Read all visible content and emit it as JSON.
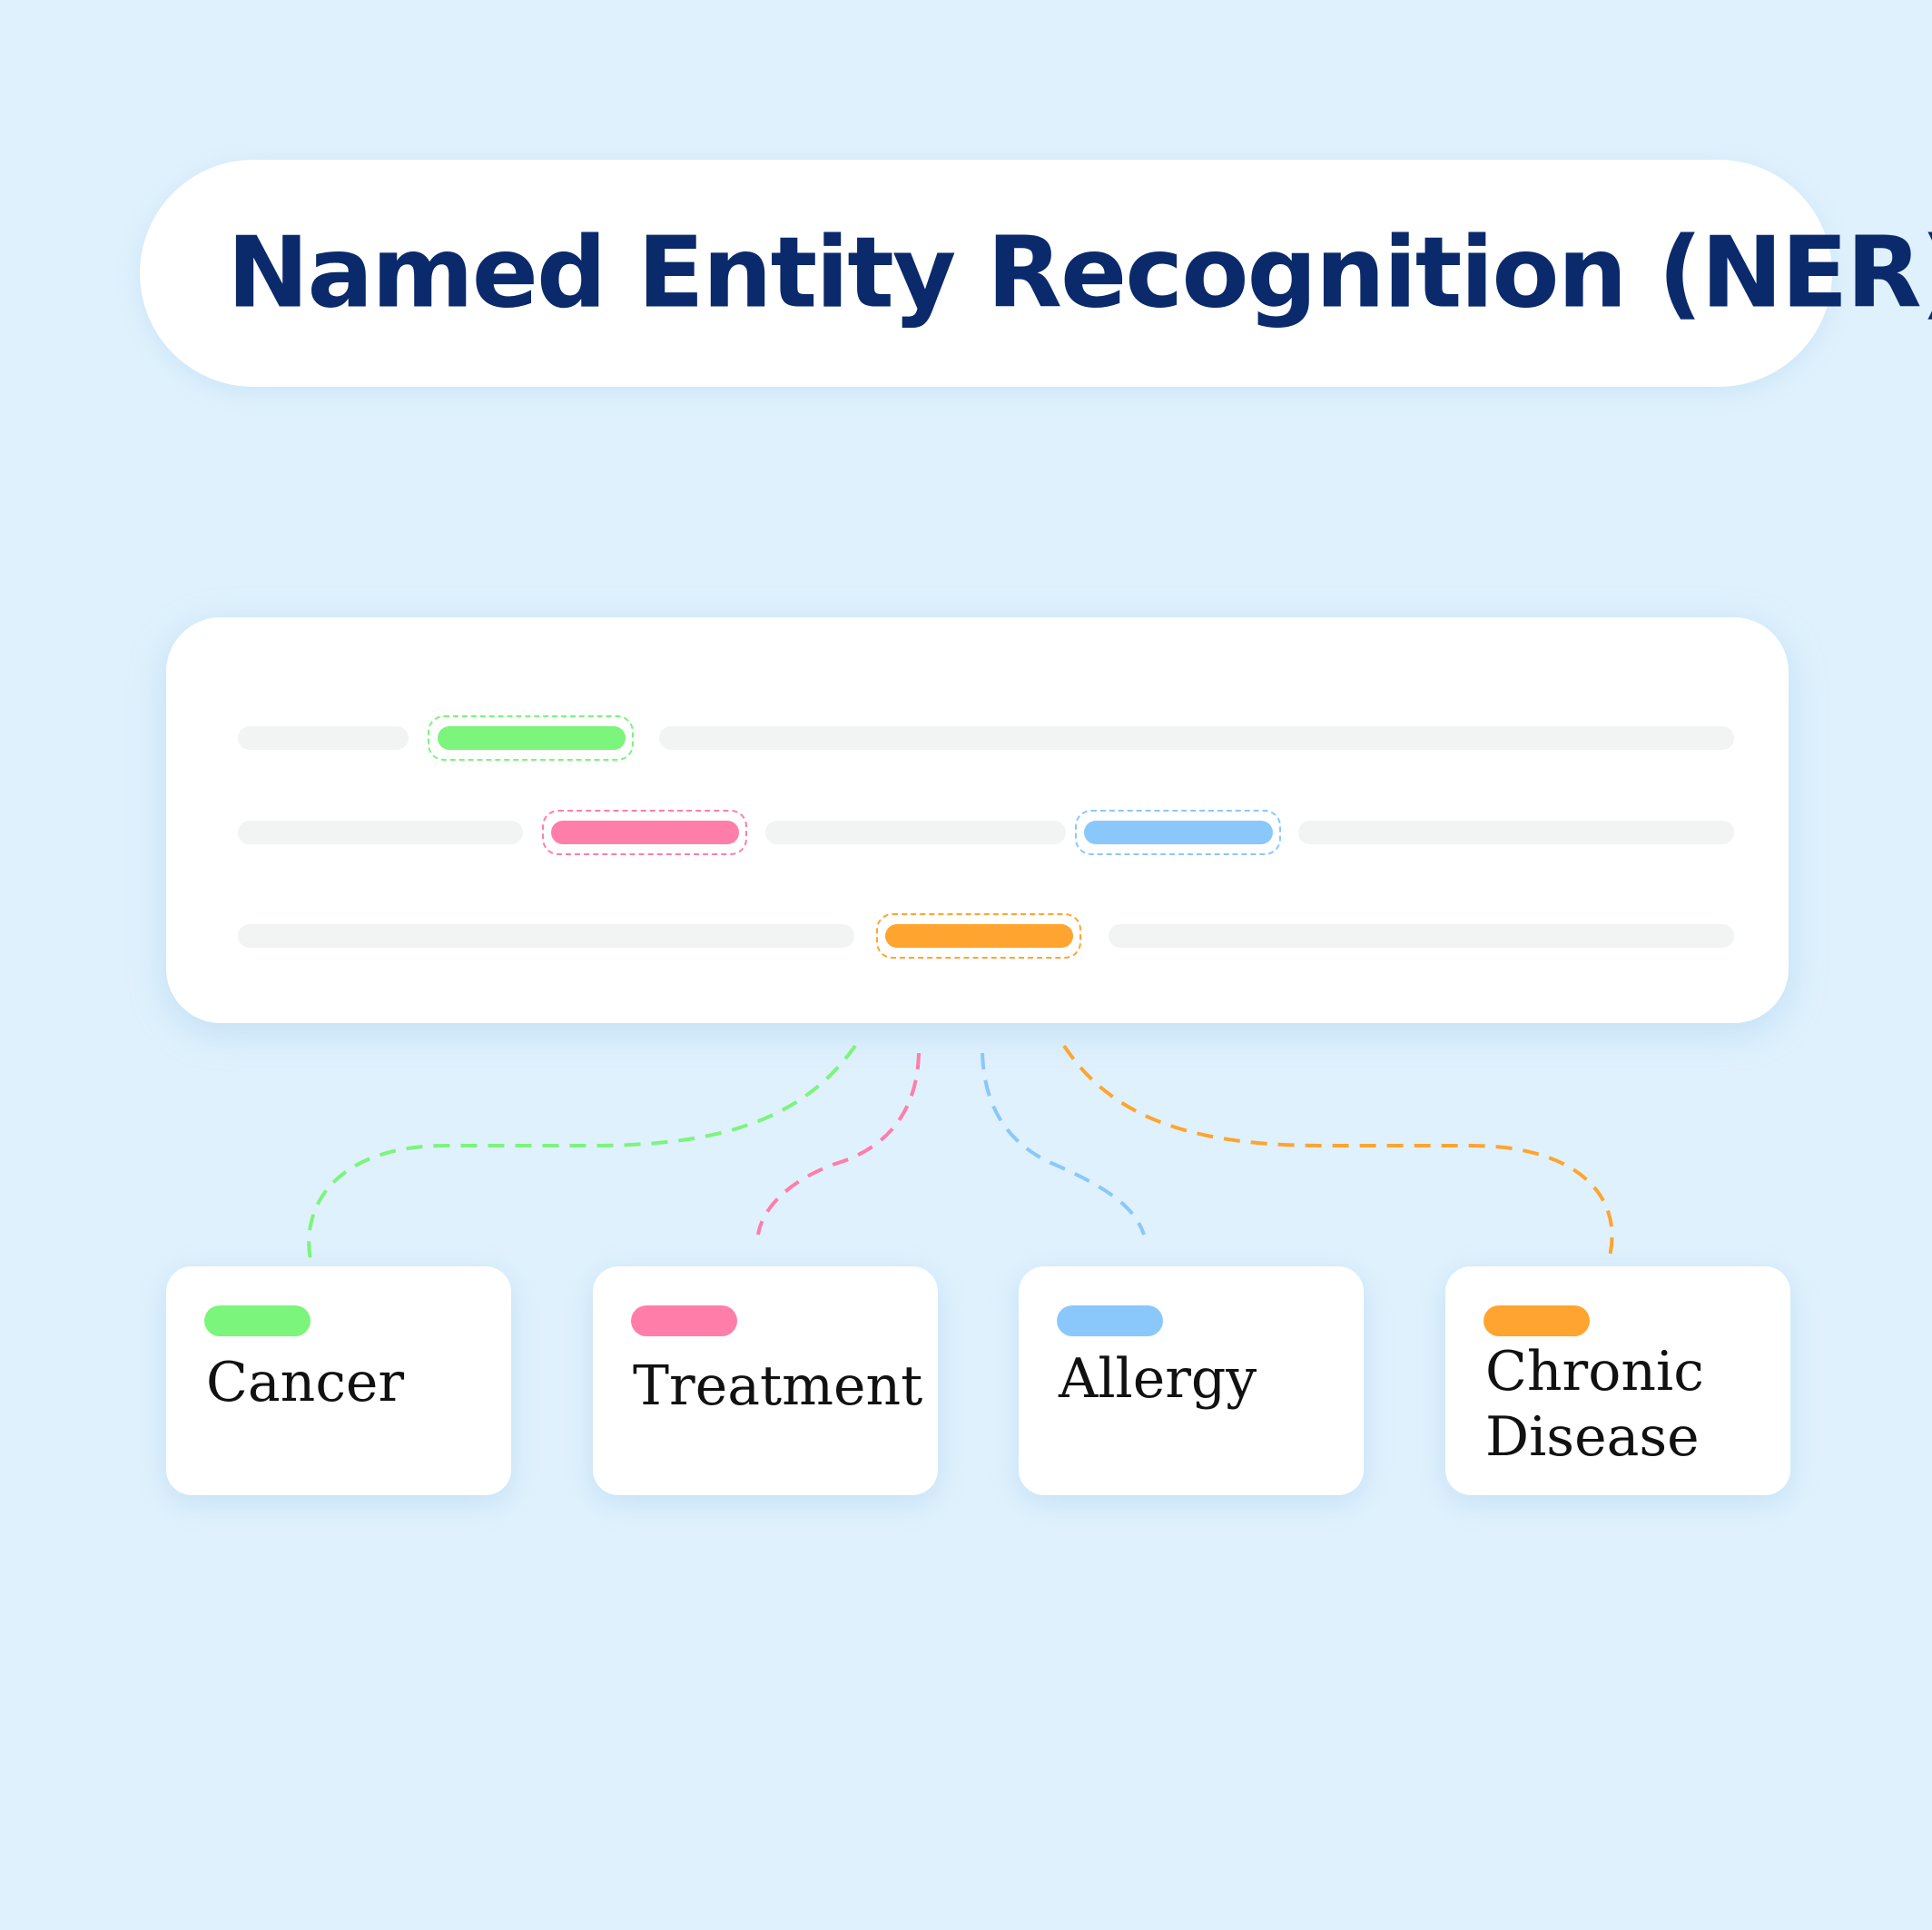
{
  "title": "Named Entity Recognition (NER)",
  "colors": {
    "background": "#dff1fd",
    "title_text": "#0b2a6b",
    "placeholder_line": "#f2f3f3",
    "cancer": "#7bf57b",
    "treatment": "#ff7ea9",
    "allergy": "#8ac8fb",
    "chronic_disease": "#ffa42e"
  },
  "categories": [
    {
      "label": "Cancer",
      "color": "#7bf57b"
    },
    {
      "label": "Treatment",
      "color": "#ff7ea9"
    },
    {
      "label": "Allergy",
      "color": "#8ac8fb"
    },
    {
      "label": "Chronic\nDisease",
      "color": "#ffa42e"
    }
  ]
}
